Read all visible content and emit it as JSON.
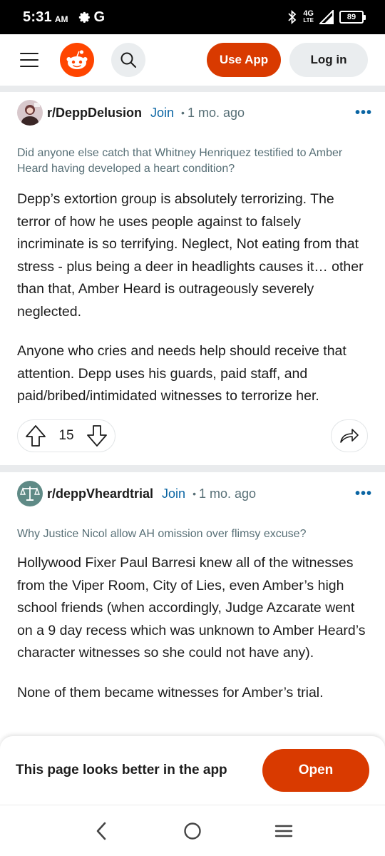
{
  "status_bar": {
    "time": "5:31",
    "ampm": "AM",
    "carrier_glyph": "G",
    "network_top": "4G",
    "network_bottom": "LTE",
    "battery": "89",
    "icons": [
      "gear-icon",
      "bluetooth-icon",
      "signal-icon",
      "battery-icon"
    ]
  },
  "header": {
    "use_app_label": "Use App",
    "login_label": "Log in",
    "icons": [
      "menu-icon",
      "reddit-logo",
      "search-icon"
    ],
    "accent": "#d93a00",
    "logo_color": "#ff4500"
  },
  "posts": [
    {
      "subreddit": "r/DeppDelusion",
      "join_label": "Join",
      "separator": "•",
      "age": "1 mo. ago",
      "more": "•••",
      "title": "Did anyone else catch that Whitney Henriquez testified to Amber Heard having developed a heart condition?",
      "paragraphs": [
        "Depp’s extortion group is absolutely terrorizing. The terror of how he uses people against to falsely incriminate is so terrifying. Neglect, Not eating from that stress - plus being a deer in headlights causes it… other than that, Amber Heard is outrageously severely neglected.",
        "Anyone who cries and needs help should receive that attention. Depp uses his guards, paid staff, and paid/bribed/intimidated witnesses to terrorize her."
      ],
      "score": "15"
    },
    {
      "subreddit": "r/deppVheardtrial",
      "join_label": "Join",
      "separator": "•",
      "age": "1 mo. ago",
      "more": "•••",
      "title": "Why Justice Nicol allow AH omission over flimsy excuse?",
      "paragraphs": [
        "Hollywood Fixer Paul Barresi knew all of the witnesses from the Viper Room, City of Lies, even Amber’s high school friends (when accordingly, Judge Azcarate went on a 9 day recess which was unknown to Amber Heard’s character witnesses so she could not have any).",
        "None of them became witnesses for Amber’s trial."
      ]
    }
  ],
  "banner": {
    "text": "This page looks better in the app",
    "open_label": "Open"
  },
  "navbar": {
    "icons": [
      "back-icon",
      "home-icon",
      "recents-icon"
    ]
  },
  "colors": {
    "join_link": "#0a65a3",
    "muted_text": "#576f76",
    "pill_bg": "#eaedef"
  }
}
